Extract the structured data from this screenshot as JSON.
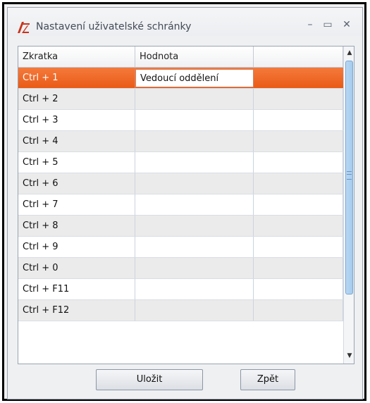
{
  "window": {
    "title": "Nastavení uživatelské schránky",
    "controls": {
      "minimize": "–",
      "maximize": "▭",
      "close": "✕"
    }
  },
  "grid": {
    "columns": [
      "Zkratka",
      "Hodnota",
      ""
    ],
    "rows": [
      {
        "shortcut": "Ctrl + 1",
        "value": "Vedoucí oddělení"
      },
      {
        "shortcut": "Ctrl + 2",
        "value": ""
      },
      {
        "shortcut": "Ctrl + 3",
        "value": ""
      },
      {
        "shortcut": "Ctrl + 4",
        "value": ""
      },
      {
        "shortcut": "Ctrl + 5",
        "value": ""
      },
      {
        "shortcut": "Ctrl + 6",
        "value": ""
      },
      {
        "shortcut": "Ctrl + 7",
        "value": ""
      },
      {
        "shortcut": "Ctrl + 8",
        "value": ""
      },
      {
        "shortcut": "Ctrl + 9",
        "value": ""
      },
      {
        "shortcut": "Ctrl + 0",
        "value": ""
      },
      {
        "shortcut": "Ctrl + F11",
        "value": ""
      },
      {
        "shortcut": "Ctrl + F12",
        "value": ""
      }
    ],
    "selected_row": 0
  },
  "buttons": {
    "save": "Uložit",
    "back": "Zpět"
  },
  "colors": {
    "selection": "#ea5a16",
    "accent": "#a4cbee"
  }
}
